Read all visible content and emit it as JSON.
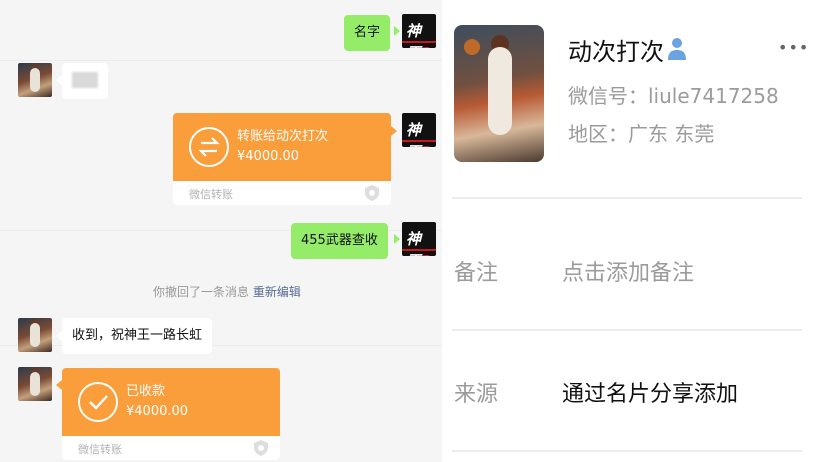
{
  "chat": {
    "messages": {
      "m1": "名字",
      "m2": "",
      "m3_transfer": {
        "title": "转账给动次打次",
        "amount": "¥4000.00",
        "footer": "微信转账"
      },
      "m4": "455武器查收",
      "system": {
        "text": "你撤回了一条消息",
        "action": "重新编辑"
      },
      "m5": "收到，祝神王一路长虹",
      "m6_transfer": {
        "title": "已收款",
        "amount": "¥4000.00",
        "footer": "微信转账"
      }
    },
    "self_avatar_logo": {
      "text": "神王",
      "num": "2"
    }
  },
  "profile": {
    "name": "动次打次",
    "wechat_id": "微信号：liule7417258",
    "region": "地区：广东 东莞",
    "remark": {
      "label": "备注",
      "value": "点击添加备注"
    },
    "source": {
      "label": "来源",
      "value": "通过名片分享添加"
    }
  },
  "colors": {
    "green_bubble": "#95ec69",
    "transfer_orange": "#fa9d3b",
    "link_blue": "#576b95",
    "person_icon": "#6aa3e0"
  }
}
